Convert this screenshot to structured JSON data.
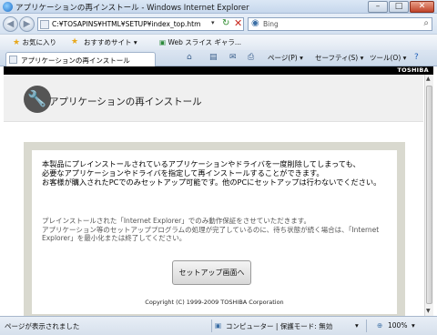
{
  "window": {
    "title": "アプリケーションの再インストール - Windows Internet Explorer"
  },
  "address_bar": {
    "url": "C:¥TOSAPINS¥HTML¥SETUP¥index_top.htm",
    "search_placeholder": "Bing"
  },
  "favorites_bar": {
    "favorites_label": "お気に入り",
    "suggested_sites_label": "おすすめサイト ▾",
    "web_slice_label": "Web スライス ギャラ..."
  },
  "tab": {
    "label": "アプリケーションの再インストール"
  },
  "command_bar": {
    "page_label": "ページ(P) ▾",
    "safety_label": "セーフティ(S) ▾",
    "tools_label": "ツール(O) ▾"
  },
  "page": {
    "brand": "TOSHIBA",
    "title": "アプリケーションの再インストール",
    "warning_lines": [
      "本製品にプレインストールされているアプリケーションやドライバを一度削除してしまっても、",
      "必要なアプリケーションやドライバを指定して再インストールすることができます。",
      "お客様が購入されたPCでのみセットアップ可能です。他のPCにセットアップは行わないでください。"
    ],
    "note_lines": [
      "プレインストールされた「Internet Explorer」でのみ動作保証をさせていただきます。",
      "アプリケーション等のセットアッププログラムの処理が完了しているのに、待ち状態が続く場合は、「Internet Explorer」を最小化または終了してください。"
    ],
    "setup_button_label": "セットアップ画面へ",
    "copyright": "Copyright (C) 1999-2009 TOSHIBA Corporation"
  },
  "status_bar": {
    "status_text": "ページが表示されました",
    "zone": "コンピューター | 保護モード: 無効",
    "zoom": "100%"
  },
  "colors": {
    "panel_frame": "#d9d9cf",
    "header_bg": "#f0f0f0",
    "top_strip": "#000000"
  }
}
